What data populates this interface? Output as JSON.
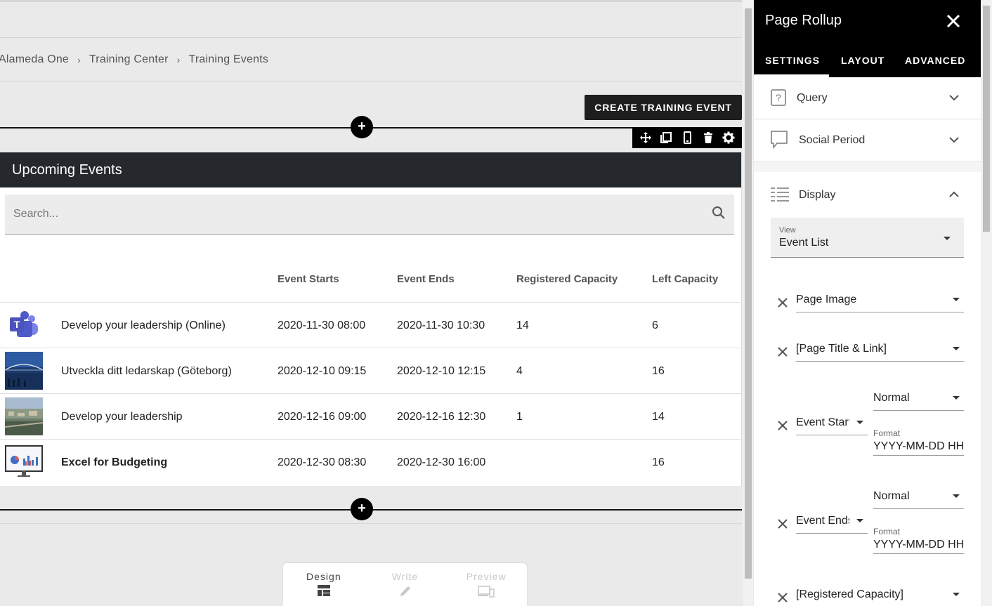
{
  "breadcrumb": {
    "items": [
      "Alameda One",
      "Training Center",
      "Training Events"
    ],
    "separator": "›"
  },
  "actions": {
    "create_label": "CREATE TRAINING EVENT",
    "add_section_label": "+"
  },
  "webpart": {
    "title": "Upcoming Events",
    "search_placeholder": "Search...",
    "columns": [
      "Event Starts",
      "Event Ends",
      "Registered Capacity",
      "Left Capacity"
    ],
    "rows": [
      {
        "title": "Develop your leadership (Online)",
        "starts": "2020-11-30 08:00",
        "ends": "2020-11-30 10:30",
        "registered": "14",
        "left": "6",
        "thumb": "teams-logo",
        "bold": false
      },
      {
        "title": "Utveckla ditt ledarskap (Göteborg)",
        "starts": "2020-12-10 09:15",
        "ends": "2020-12-10 12:15",
        "registered": "4",
        "left": "16",
        "thumb": "bridge-photo",
        "bold": false
      },
      {
        "title": "Develop your leadership",
        "starts": "2020-12-16 09:00",
        "ends": "2020-12-16 12:30",
        "registered": "1",
        "left": "14",
        "thumb": "city-photo",
        "bold": false
      },
      {
        "title": "Excel for Budgeting",
        "starts": "2020-12-30 08:30",
        "ends": "2020-12-30 16:00",
        "registered": "",
        "left": "16",
        "thumb": "monitor-chart",
        "bold": true
      }
    ]
  },
  "modebar": {
    "design": "Design",
    "write": "Write",
    "preview": "Preview",
    "active": "design"
  },
  "panel": {
    "title": "Page Rollup",
    "tabs": [
      "SETTINGS",
      "LAYOUT",
      "ADVANCED"
    ],
    "active_tab": "SETTINGS",
    "sections": {
      "query": "Query",
      "social": "Social Period",
      "display": "Display"
    },
    "view_label": "View",
    "view_value": "Event List",
    "fields": {
      "page_image": "Page Image",
      "page_title": "[Page Title & Link]",
      "event_start": "Event Start",
      "event_ends": "Event Ends",
      "registered": "[Registered Capacity]",
      "normal_1": "Normal",
      "normal_2": "Normal",
      "format_label_1": "Format",
      "format_label_2": "Format",
      "format_value_1": "YYYY-MM-DD HH:mm",
      "format_value_2": "YYYY-MM-DD HH:mm"
    }
  },
  "colors": {
    "header_bg": "#25282c",
    "panel_header_bg": "#000000",
    "canvas_bg": "#eaeaea"
  }
}
